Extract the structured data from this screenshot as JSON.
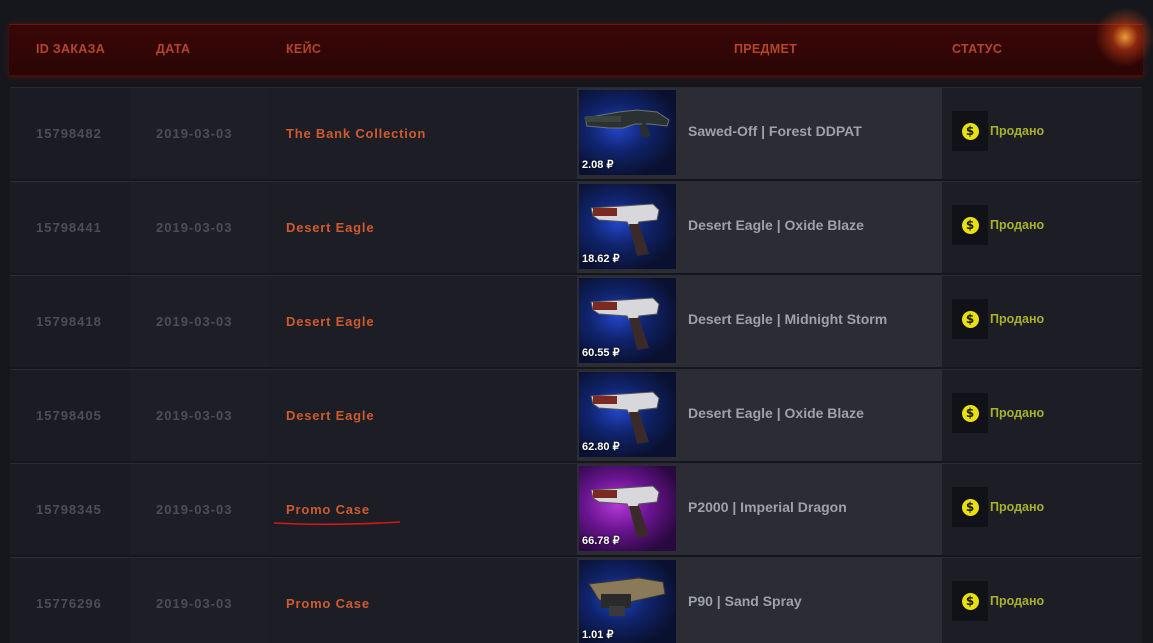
{
  "table": {
    "headers": {
      "id": "ID ЗАКАЗА",
      "date": "ДАТА",
      "case": "КЕЙС",
      "item": "ПРЕДМЕТ",
      "status": "СТАТУС"
    },
    "rows": [
      {
        "id": "15798482",
        "date": "2019-03-03",
        "case": "The Bank Collection",
        "price": "2.08 ₽",
        "item": "Sawed-Off | Forest DDPAT",
        "status": "Продано",
        "weapon_icon": "shotgun-icon",
        "rarity_color": "#2346c9"
      },
      {
        "id": "15798441",
        "date": "2019-03-03",
        "case": "Desert Eagle",
        "price": "18.62 ₽",
        "item": "Desert Eagle | Oxide Blaze",
        "status": "Продано",
        "weapon_icon": "pistol-icon",
        "rarity_color": "#2346c9"
      },
      {
        "id": "15798418",
        "date": "2019-03-03",
        "case": "Desert Eagle",
        "price": "60.55 ₽",
        "item": "Desert Eagle | Midnight Storm",
        "status": "Продано",
        "weapon_icon": "pistol-icon",
        "rarity_color": "#2346c9"
      },
      {
        "id": "15798405",
        "date": "2019-03-03",
        "case": "Desert Eagle",
        "price": "62.80 ₽",
        "item": "Desert Eagle | Oxide Blaze",
        "status": "Продано",
        "weapon_icon": "pistol-icon",
        "rarity_color": "#2346c9"
      },
      {
        "id": "15798345",
        "date": "2019-03-03",
        "case": "Promo Case",
        "price": "66.78 ₽",
        "item": "P2000 | Imperial Dragon",
        "status": "Продано",
        "weapon_icon": "pistol-icon",
        "rarity_color": "#b43ad8"
      },
      {
        "id": "15776296",
        "date": "2019-03-03",
        "case": "Promo Case",
        "price": "1.01 ₽",
        "item": "P90 | Sand Spray",
        "status": "Продано",
        "weapon_icon": "smg-icon",
        "rarity_color": "#2346c9"
      }
    ]
  },
  "status_icon": "coin-icon",
  "status_icon_glyph": "$",
  "colors": {
    "case_text": "#cf5a2e",
    "status_text": "#a8b12e",
    "header_bg": "#3a0707",
    "annotation_underline": "#d01818"
  }
}
